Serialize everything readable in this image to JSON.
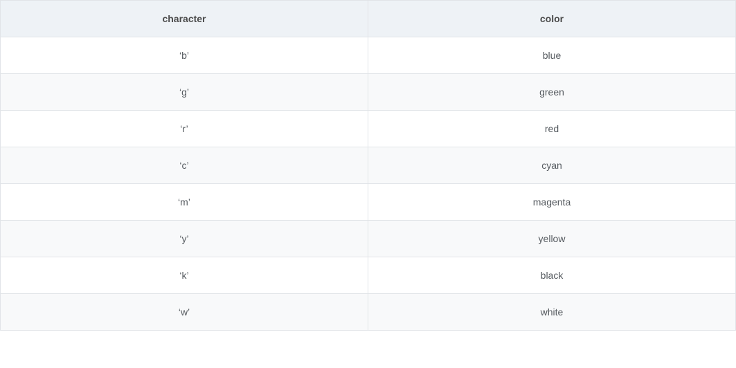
{
  "table": {
    "headers": [
      "character",
      "color"
    ],
    "rows": [
      {
        "character": "‘b’",
        "color": "blue"
      },
      {
        "character": "‘g’",
        "color": "green"
      },
      {
        "character": "‘r’",
        "color": "red"
      },
      {
        "character": "‘c’",
        "color": "cyan"
      },
      {
        "character": "‘m’",
        "color": "magenta"
      },
      {
        "character": "‘y’",
        "color": "yellow"
      },
      {
        "character": "‘k’",
        "color": "black"
      },
      {
        "character": "‘w’",
        "color": "white"
      }
    ]
  }
}
